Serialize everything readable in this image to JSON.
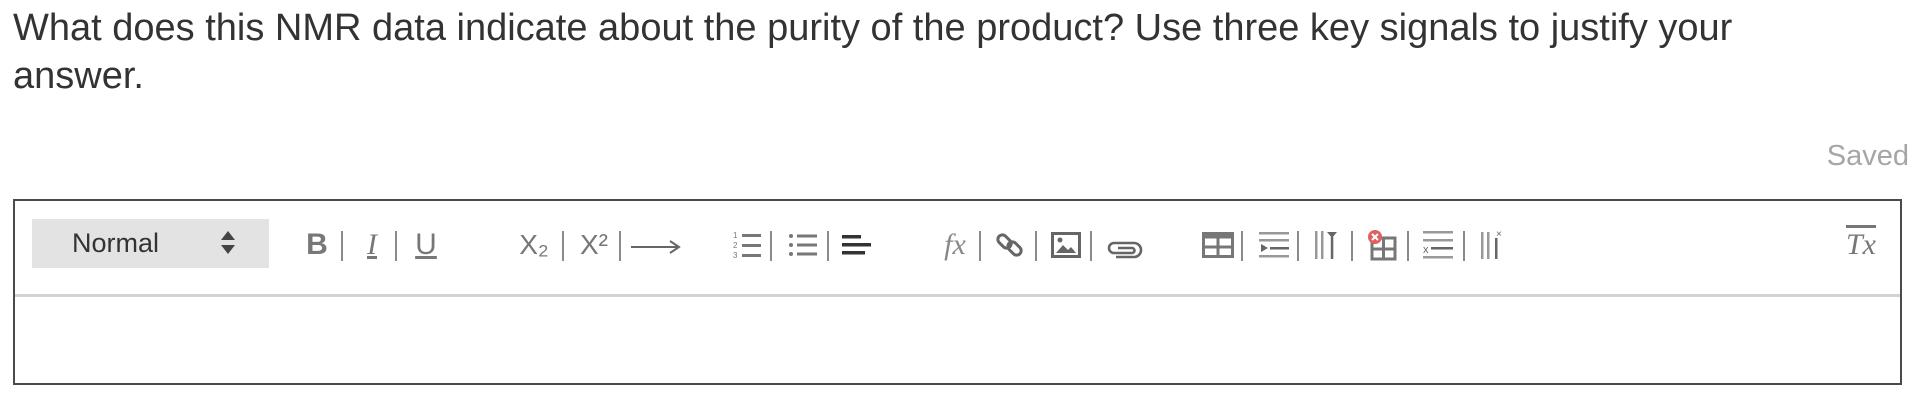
{
  "question": {
    "text": "What does this NMR data indicate about the purity of the product? Use three key signals to justify your answer."
  },
  "status": {
    "saved_label": "Saved"
  },
  "editor": {
    "format_select": {
      "selected": "Normal"
    },
    "toolbar": [
      {
        "name": "bold",
        "icon": "bold-icon",
        "label": "B"
      },
      {
        "name": "italic",
        "icon": "italic-icon",
        "label": "I"
      },
      {
        "name": "underline",
        "icon": "underline-icon",
        "label": "U"
      },
      {
        "name": "subscript",
        "icon": "subscript-icon",
        "label": "X₂"
      },
      {
        "name": "superscript",
        "icon": "superscript-icon",
        "label": "X²"
      },
      {
        "name": "arrow",
        "icon": "long-arrow-icon",
        "label": "⟶"
      },
      {
        "name": "ordered-list",
        "icon": "ordered-list-icon"
      },
      {
        "name": "bullet-list",
        "icon": "bullet-list-icon"
      },
      {
        "name": "align",
        "icon": "align-left-icon"
      },
      {
        "name": "formula",
        "icon": "formula-icon",
        "label": "fx"
      },
      {
        "name": "link",
        "icon": "link-icon"
      },
      {
        "name": "image",
        "icon": "image-icon"
      },
      {
        "name": "attachment",
        "icon": "paperclip-icon"
      },
      {
        "name": "table",
        "icon": "table-icon"
      },
      {
        "name": "insert-row",
        "icon": "insert-row-icon"
      },
      {
        "name": "insert-column",
        "icon": "insert-column-icon"
      },
      {
        "name": "delete-table",
        "icon": "delete-table-icon"
      },
      {
        "name": "delete-row",
        "icon": "delete-row-icon"
      },
      {
        "name": "delete-column",
        "icon": "delete-column-icon"
      },
      {
        "name": "clear-format",
        "icon": "clear-format-icon",
        "label": "Tx"
      }
    ],
    "content": ""
  },
  "colors": {
    "text": "#333333",
    "muted": "#a6a6a6",
    "border": "#4a4a4a",
    "select_bg": "#e3e3e3",
    "icon": "#555555",
    "delete_red": "#e06060"
  }
}
